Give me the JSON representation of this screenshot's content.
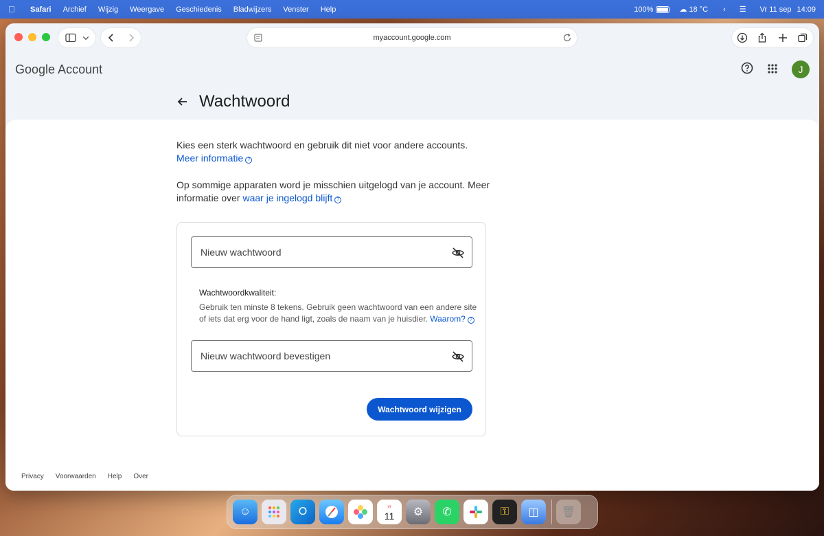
{
  "menubar": {
    "app": "Safari",
    "items": [
      "Archief",
      "Wijzig",
      "Weergave",
      "Geschiedenis",
      "Bladwijzers",
      "Venster",
      "Help"
    ],
    "battery": "100%",
    "weather": "18 °C",
    "date": "Vr 11 sep",
    "time": "14:09"
  },
  "browser": {
    "url": "myaccount.google.com"
  },
  "header": {
    "logo_google": "Google",
    "logo_account": "Account",
    "avatar_letter": "J"
  },
  "page": {
    "title": "Wachtwoord",
    "intro1_text": "Kies een sterk wachtwoord en gebruik dit niet voor andere accounts.",
    "intro1_link": "Meer informatie",
    "intro2_text": "Op sommige apparaten word je misschien uitgelogd van je account. Meer informatie over",
    "intro2_link": "waar je ingelogd blijft",
    "field_new_placeholder": "Nieuw wachtwoord",
    "quality_title": "Wachtwoordkwaliteit:",
    "quality_text": "Gebruik ten minste 8 tekens. Gebruik geen wachtwoord van een andere site of iets dat erg voor de hand ligt, zoals de naam van je huisdier.",
    "quality_link": "Waarom?",
    "field_confirm_placeholder": "Nieuw wachtwoord bevestigen",
    "submit_label": "Wachtwoord wijzigen"
  },
  "footer": {
    "links": [
      "Privacy",
      "Voorwaarden",
      "Help",
      "Over"
    ]
  },
  "dock": {
    "calendar_month": "vr",
    "calendar_day": "11",
    "apps": [
      "finder-icon",
      "launchpad-icon",
      "outlook-icon",
      "safari-icon",
      "photos-icon",
      "calendar-icon",
      "system-settings-icon",
      "whatsapp-icon",
      "slack-icon",
      "keychain-icon",
      "storage-icon",
      "trash-icon"
    ]
  },
  "colors": {
    "accent": "#0b57d0",
    "menubar": "#3b6fd9",
    "avatar": "#4f8a2b"
  }
}
